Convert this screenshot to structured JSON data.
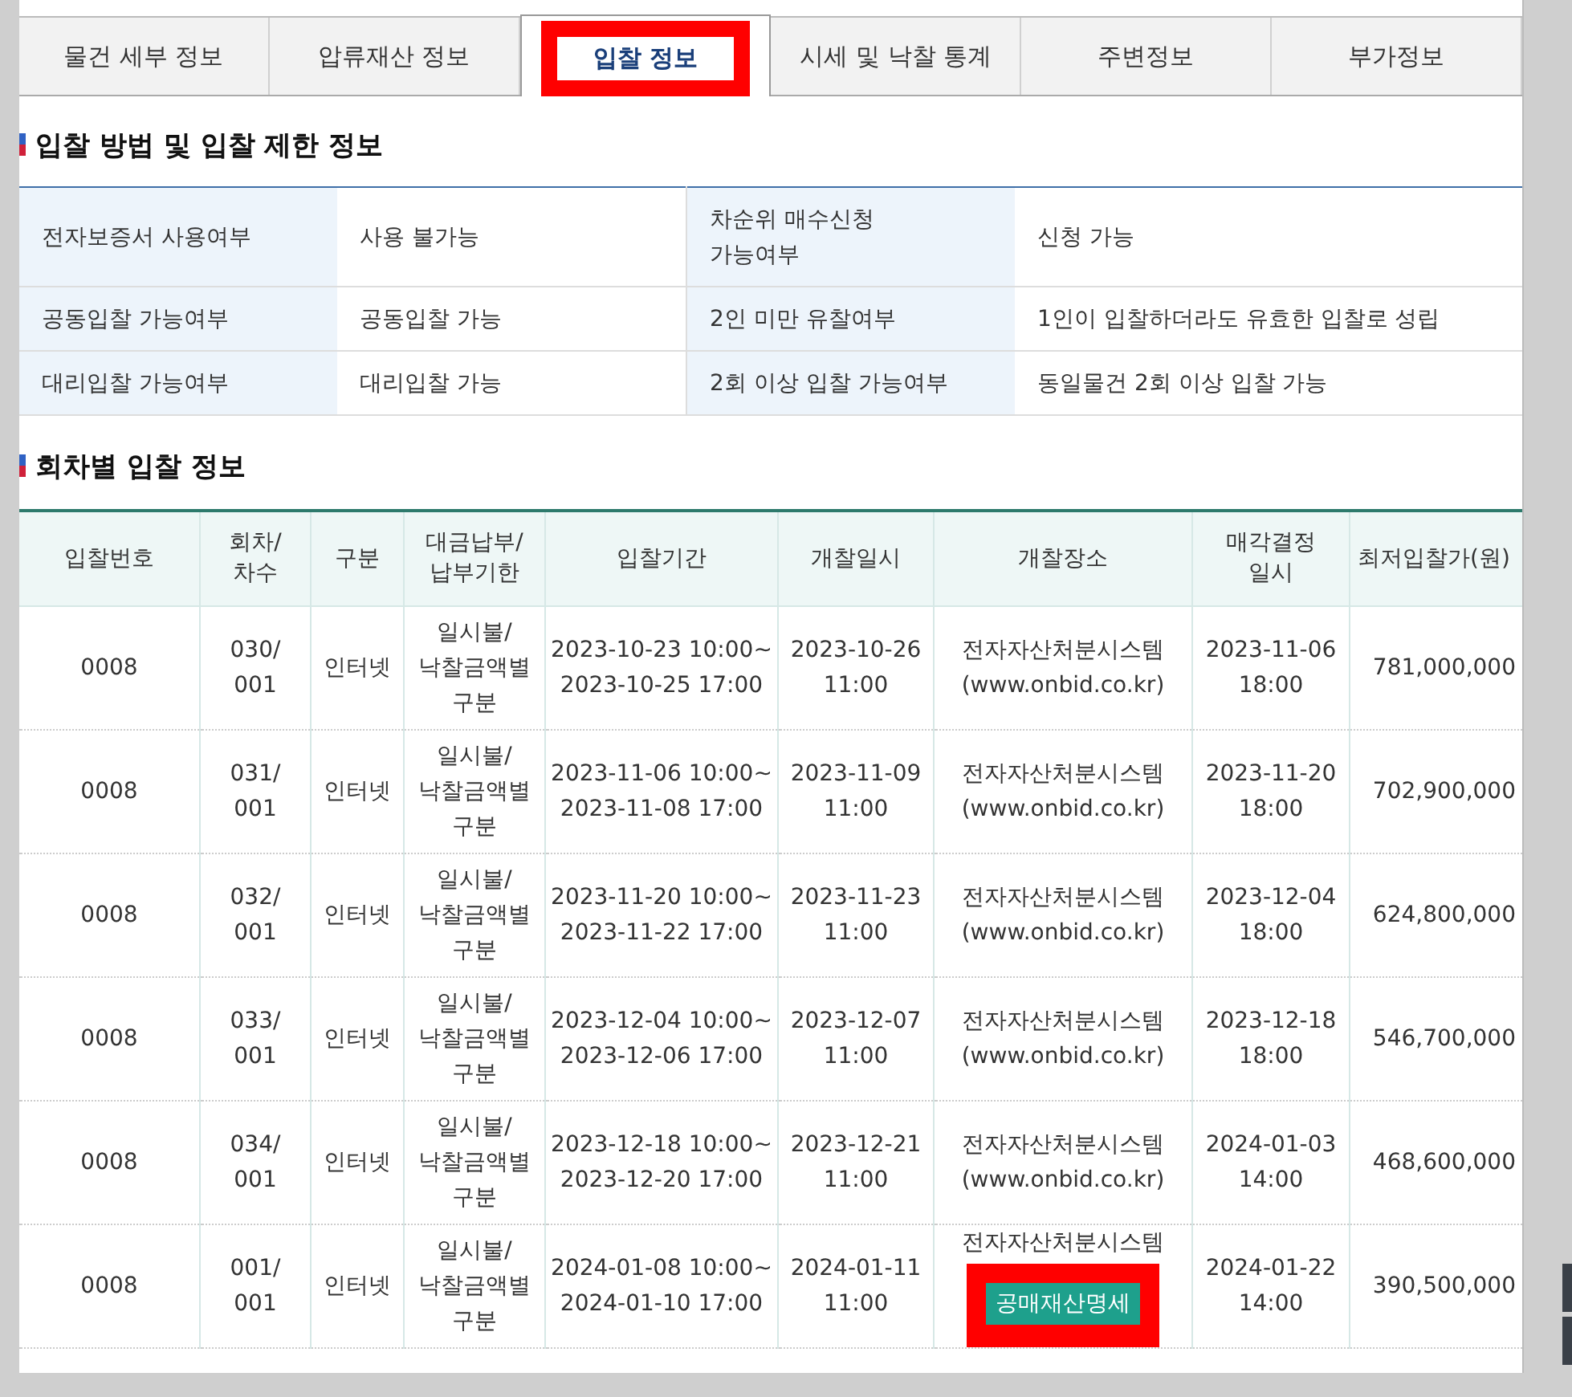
{
  "tabs": [
    {
      "label": "물건 세부 정보",
      "selected": false,
      "highlighted": false
    },
    {
      "label": "압류재산 정보",
      "selected": false,
      "highlighted": false
    },
    {
      "label": "입찰 정보",
      "selected": true,
      "highlighted": true
    },
    {
      "label": "시세 및 낙찰 통계",
      "selected": false,
      "highlighted": false
    },
    {
      "label": "주변정보",
      "selected": false,
      "highlighted": false
    },
    {
      "label": "부가정보",
      "selected": false,
      "highlighted": false
    }
  ],
  "method_section": {
    "title": "입찰 방법 및 입찰 제한 정보",
    "rows": [
      {
        "pairs": [
          {
            "label": "전자보증서 사용여부",
            "value": "사용 불가능"
          },
          {
            "label": "차순위 매수신청\n가능여부",
            "value": "신청 가능"
          }
        ]
      },
      {
        "pairs": [
          {
            "label": "공동입찰 가능여부",
            "value": "공동입찰 가능"
          },
          {
            "label": "2인 미만 유찰여부",
            "value": "1인이 입찰하더라도 유효한 입찰로 성립"
          }
        ]
      },
      {
        "pairs": [
          {
            "label": "대리입찰 가능여부",
            "value": "대리입찰 가능"
          },
          {
            "label": "2회 이상 입찰 가능여부",
            "value": "동일물건 2회 이상 입찰 가능"
          }
        ]
      }
    ]
  },
  "rounds_section": {
    "title": "회차별 입찰 정보",
    "columns": [
      "입찰번호",
      "회차/\n차수",
      "구분",
      "대금납부/\n납부기한",
      "입찰기간",
      "개찰일시",
      "개찰장소",
      "매각결정\n일시",
      "최저입찰가(원)"
    ],
    "rows": [
      {
        "bid_no": "0008",
        "round": "030/\n001",
        "type": "인터넷",
        "payment": "일시불/\n낙찰금액별\n구분",
        "period": "2023-10-23 10:00~\n2023-10-25 17:00",
        "open_date": "2023-10-26\n11:00",
        "location": "전자자산처분시스템",
        "location_url": "(www.onbid.co.kr)",
        "decision_date": "2023-11-06\n18:00",
        "min_price": "781,000,000"
      },
      {
        "bid_no": "0008",
        "round": "031/\n001",
        "type": "인터넷",
        "payment": "일시불/\n낙찰금액별\n구분",
        "period": "2023-11-06 10:00~\n2023-11-08 17:00",
        "open_date": "2023-11-09\n11:00",
        "location": "전자자산처분시스템",
        "location_url": "(www.onbid.co.kr)",
        "decision_date": "2023-11-20\n18:00",
        "min_price": "702,900,000"
      },
      {
        "bid_no": "0008",
        "round": "032/\n001",
        "type": "인터넷",
        "payment": "일시불/\n낙찰금액별\n구분",
        "period": "2023-11-20 10:00~\n2023-11-22 17:00",
        "open_date": "2023-11-23\n11:00",
        "location": "전자자산처분시스템",
        "location_url": "(www.onbid.co.kr)",
        "decision_date": "2023-12-04\n18:00",
        "min_price": "624,800,000"
      },
      {
        "bid_no": "0008",
        "round": "033/\n001",
        "type": "인터넷",
        "payment": "일시불/\n낙찰금액별\n구분",
        "period": "2023-12-04 10:00~\n2023-12-06 17:00",
        "open_date": "2023-12-07\n11:00",
        "location": "전자자산처분시스템",
        "location_url": "(www.onbid.co.kr)",
        "decision_date": "2023-12-18\n18:00",
        "min_price": "546,700,000"
      },
      {
        "bid_no": "0008",
        "round": "034/\n001",
        "type": "인터넷",
        "payment": "일시불/\n낙찰금액별\n구분",
        "period": "2023-12-18 10:00~\n2023-12-20 17:00",
        "open_date": "2023-12-21\n11:00",
        "location": "전자자산처분시스템",
        "location_url": "(www.onbid.co.kr)",
        "decision_date": "2024-01-03\n14:00",
        "min_price": "468,600,000"
      },
      {
        "bid_no": "0008",
        "round": "001/\n001",
        "type": "인터넷",
        "payment": "일시불/\n낙찰금액별\n구분",
        "period": "2024-01-08 10:00~\n2024-01-10 17:00",
        "open_date": "2024-01-11\n11:00",
        "location": "전자자산처분시스템",
        "button": {
          "label": "공매재산명세",
          "highlighted": true
        },
        "decision_date": "2024-01-22\n14:00",
        "min_price": "390,500,000"
      }
    ]
  }
}
